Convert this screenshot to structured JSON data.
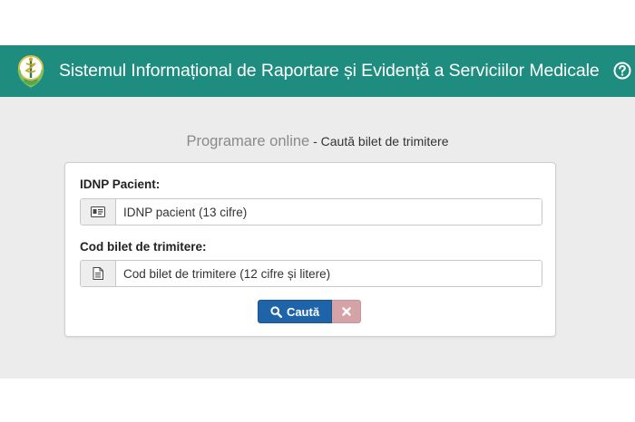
{
  "header": {
    "title": "Sistemul Informațional de Raportare și Evidență a Serviciilor Medicale",
    "logo_icon": "medical-caduceus-logo-icon",
    "help_icon": "question-circle-icon",
    "color": "#1e8c7e"
  },
  "page": {
    "heading": "Programare online",
    "subheading": " - Caută bilet de trimitere"
  },
  "form": {
    "idnp_label": "IDNP Pacient:",
    "idnp_placeholder": "IDNP pacient (13 cifre)",
    "idnp_value": "",
    "idnp_icon": "id-card-icon",
    "code_label": "Cod bilet de trimitere:",
    "code_placeholder": "Cod bilet de trimitere (12 cifre și litere)",
    "code_value": "",
    "code_icon": "document-icon",
    "search_label": "Caută",
    "search_icon": "search-icon",
    "clear_icon": "close-icon",
    "search_color": "#1f64a8",
    "clear_color": "#d4a3a7"
  }
}
